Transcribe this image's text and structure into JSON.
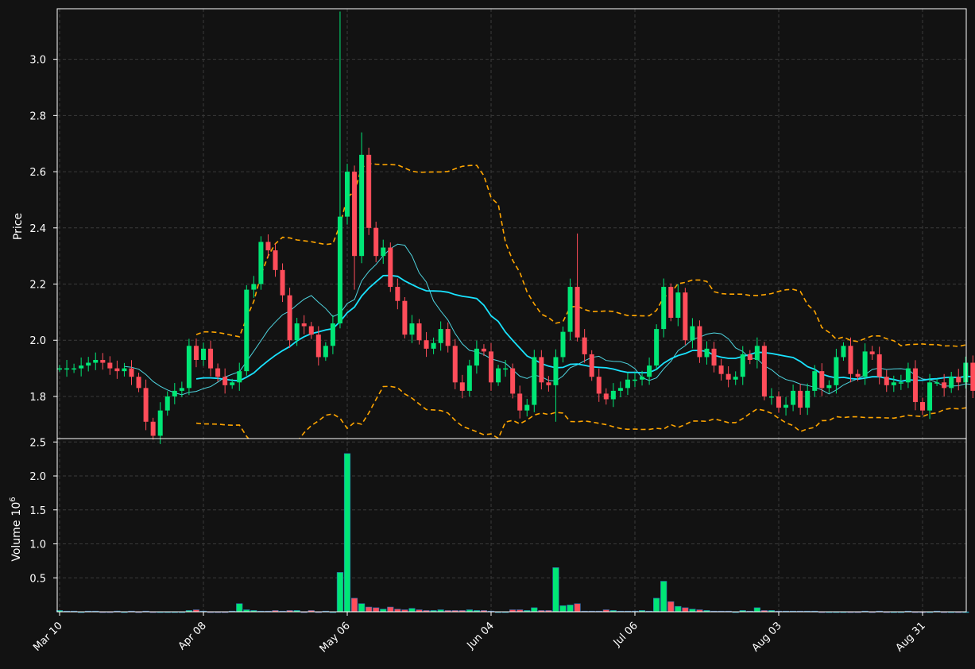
{
  "colors": {
    "background": "#121212",
    "up": "#00e676",
    "down": "#ff4d5a",
    "ma_fast": "#19e3ff",
    "ma_slow": "#4fd5e0",
    "band": "#ffa500",
    "grid": "#3a3a3a",
    "axis": "#ffffff"
  },
  "chart_data": {
    "type": "candlestick",
    "price_panel": {
      "ylabel": "Price",
      "ylim": [
        1.65,
        3.18
      ],
      "yticks": [
        "1.8",
        "2.0",
        "2.2",
        "2.4",
        "2.6",
        "2.8",
        "3.0"
      ],
      "ytick_values": [
        1.8,
        2.0,
        2.2,
        2.4,
        2.6,
        2.8,
        3.0
      ],
      "grid": true,
      "overlays": [
        "moving average (fast)",
        "moving average (slow)",
        "upper band",
        "lower band"
      ]
    },
    "volume_panel": {
      "ylabel": "Volume",
      "unit_exponent": "6",
      "ylim": [
        0,
        2.55
      ],
      "yticks": [
        "0.5",
        "1.0",
        "1.5",
        "2.0",
        "2.5"
      ],
      "ytick_values": [
        0.5,
        1.0,
        1.5,
        2.0,
        2.5
      ],
      "grid": true
    },
    "x_axis": {
      "tick_labels": [
        "Mar 10",
        "Apr 08",
        "May 06",
        "Jun 04",
        "Jul 06",
        "Aug 03",
        "Aug 31"
      ],
      "tick_indices": [
        0,
        20,
        40,
        60,
        80,
        100,
        120
      ],
      "n_bars": 127
    },
    "series": {
      "close": [
        1.9,
        1.9,
        1.9,
        1.91,
        1.92,
        1.93,
        1.92,
        1.9,
        1.89,
        1.9,
        1.87,
        1.83,
        1.71,
        1.66,
        1.75,
        1.8,
        1.82,
        1.83,
        1.98,
        1.93,
        1.97,
        1.9,
        1.87,
        1.84,
        1.85,
        1.89,
        2.18,
        2.2,
        2.35,
        2.32,
        2.25,
        2.16,
        2.0,
        2.06,
        2.05,
        2.02,
        1.94,
        1.98,
        2.06,
        2.44,
        2.6,
        2.3,
        2.66,
        2.4,
        2.3,
        2.33,
        2.19,
        2.14,
        2.02,
        2.06,
        2.0,
        1.97,
        1.99,
        2.04,
        1.98,
        1.85,
        1.82,
        1.91,
        1.97,
        1.96,
        1.85,
        1.9,
        1.9,
        1.81,
        1.75,
        1.77,
        1.94,
        1.85,
        1.84,
        1.94,
        2.03,
        2.19,
        2.01,
        1.95,
        1.87,
        1.81,
        1.79,
        1.82,
        1.83,
        1.86,
        1.86,
        1.87,
        1.91,
        2.04,
        2.19,
        2.08,
        2.17,
        2.0,
        2.05,
        1.94,
        1.97,
        1.91,
        1.88,
        1.86,
        1.87,
        1.95,
        1.93,
        1.98,
        1.8,
        1.8,
        1.76,
        1.77,
        1.82,
        1.76,
        1.82,
        1.89,
        1.83,
        1.84,
        1.94,
        1.98,
        1.88,
        1.87,
        1.96,
        1.95,
        1.87,
        1.84,
        1.85,
        1.85,
        1.9,
        1.78,
        1.75,
        1.85,
        1.85,
        1.83,
        1.87,
        1.85,
        1.92,
        1.82
      ],
      "volume": [
        0.02,
        0.01,
        0.01,
        0.0,
        0.01,
        0.01,
        0.0,
        0.0,
        0.01,
        0.0,
        0.01,
        0.0,
        0.01,
        0.0,
        0.0,
        0.0,
        0.0,
        0.0,
        0.02,
        0.03,
        0.01,
        0.0,
        0.0,
        0.0,
        0.01,
        0.12,
        0.03,
        0.02,
        0.01,
        0.01,
        0.02,
        0.01,
        0.02,
        0.02,
        0.0,
        0.02,
        0.0,
        0.01,
        0.0,
        0.58,
        2.33,
        0.2,
        0.12,
        0.07,
        0.06,
        0.04,
        0.07,
        0.04,
        0.03,
        0.05,
        0.03,
        0.02,
        0.02,
        0.03,
        0.02,
        0.02,
        0.02,
        0.03,
        0.02,
        0.02,
        0.01,
        0.0,
        0.0,
        0.03,
        0.03,
        0.02,
        0.06,
        0.02,
        0.02,
        0.65,
        0.09,
        0.1,
        0.12,
        0.01,
        0.01,
        0.01,
        0.03,
        0.02,
        0.01,
        0.01,
        0.01,
        0.02,
        0.01,
        0.2,
        0.45,
        0.15,
        0.08,
        0.06,
        0.04,
        0.03,
        0.02,
        0.01,
        0.01,
        0.01,
        0.0,
        0.02,
        0.01,
        0.06,
        0.02,
        0.02,
        0.01,
        0.01,
        0.01,
        0.01,
        0.01,
        0.01,
        0.0,
        0.0,
        0.0,
        0.0,
        0.0,
        0.0,
        0.01,
        0.0,
        0.01,
        0.0,
        0.0,
        0.0,
        0.01,
        0.0,
        0.0,
        0.0,
        0.01,
        0.0,
        0.0,
        0.0,
        0.0
      ]
    }
  }
}
